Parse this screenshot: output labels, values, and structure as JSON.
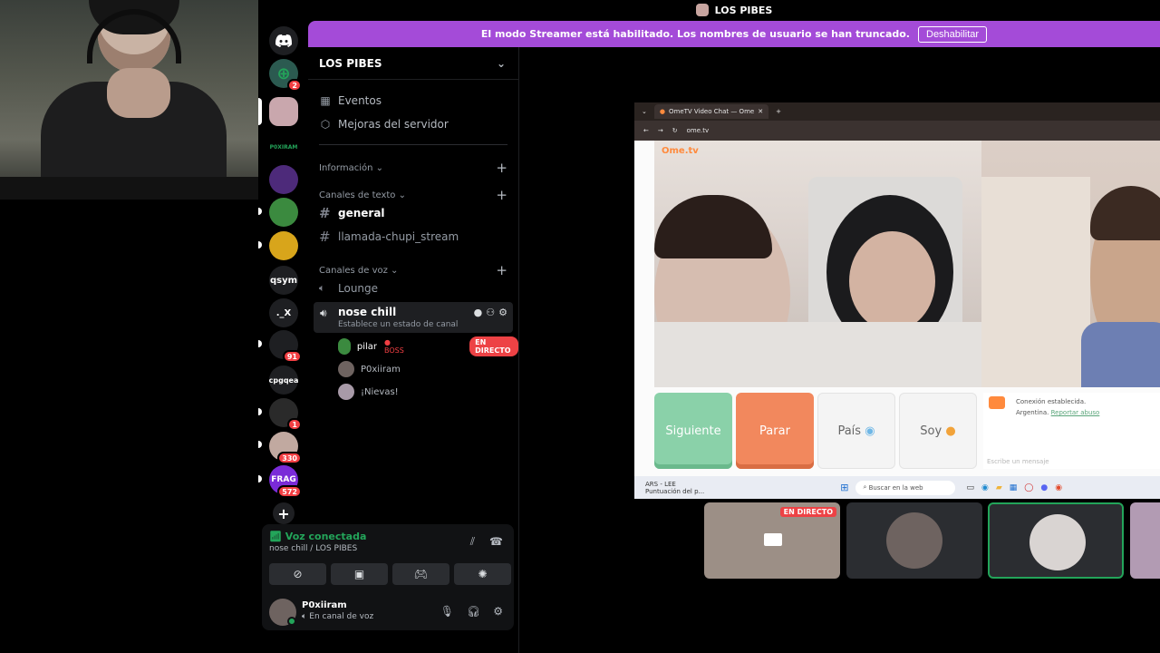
{
  "window_title": "LOS PIBES",
  "streamer_banner": {
    "text": "El modo Streamer está habilitado. Los nombres de usuario se han truncado.",
    "button_label": "Deshabilitar"
  },
  "rail": {
    "items": [
      {
        "label": "",
        "badge": ""
      },
      {
        "label": "",
        "badge": "2"
      },
      {
        "label": "",
        "badge": ""
      },
      {
        "label": "P0XIRAM",
        "badge": ""
      },
      {
        "label": "",
        "badge": ""
      },
      {
        "label": "",
        "badge": ""
      },
      {
        "label": "",
        "badge": ""
      },
      {
        "label": "qsym",
        "badge": ""
      },
      {
        "label": "._X",
        "badge": ""
      },
      {
        "label": "",
        "badge": "91"
      },
      {
        "label": "cpgqea",
        "badge": ""
      },
      {
        "label": "",
        "badge": "1"
      },
      {
        "label": "",
        "badge": "330"
      },
      {
        "label": "FRAG",
        "badge": "572"
      }
    ]
  },
  "sidebar": {
    "guild_name": "LOS PIBES",
    "nav": [
      "Eventos",
      "Mejoras del servidor"
    ],
    "categories": {
      "info": "Información",
      "text": "Canales de texto",
      "voice": "Canales de voz"
    },
    "text_channels": [
      "general",
      "llamada-chupi_stream"
    ],
    "voice_channels": [
      "Lounge",
      "nose chill"
    ],
    "voice_status": "Establece un estado de canal",
    "voice_users": [
      {
        "name": "pilar",
        "tag": "BOSS",
        "live": "EN DIRECTO"
      },
      {
        "name": "P0xiiram",
        "tag": "",
        "live": ""
      },
      {
        "name": "¡Nievas!",
        "tag": "",
        "live": ""
      }
    ]
  },
  "voice_panel": {
    "title": "Voz conectada",
    "subtitle": "nose chill / LOS PIBES",
    "user": {
      "name": "P0xiiram",
      "status": "En canal de voz"
    }
  },
  "stream": {
    "browser_tab": "OmeTV Video Chat — Ome",
    "address": "ome.tv",
    "logo": "Ome.tv",
    "buttons": [
      "Siguiente",
      "Parar",
      "País",
      "Soy"
    ],
    "chat": {
      "line1": "Conexión establecida.",
      "line2": "Argentina.",
      "link": "Reportar abuso",
      "placeholder": "Escribe un mensaje"
    },
    "taskbar": {
      "weather_line1": "ARS - LEE",
      "weather_line2": "Puntuación del p...",
      "search": "Buscar en la web"
    }
  },
  "tiles": {
    "live_label": "EN DIRECTO"
  },
  "colors": {
    "accent": "#a44bd8",
    "online": "#23a55a",
    "live": "#ed4245"
  }
}
